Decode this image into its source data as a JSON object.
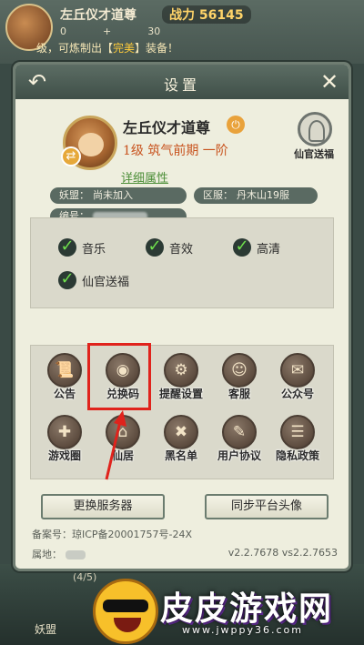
{
  "background": {
    "player_name": "左丘仪才道尊",
    "power_label": "战力",
    "power_value": "56145",
    "counter_left": "0",
    "counter_plus": "+",
    "counter_right": "30",
    "ticker_prefix": "级，可炼制出【",
    "ticker_highlight": "完美",
    "ticker_suffix": "】装备！",
    "progress": "(4/5)",
    "guild_label": "妖盟",
    "watermark": "皮皮游戏网",
    "watermark_url": "www.jwppy36.com"
  },
  "dialog": {
    "title": "设置",
    "back_icon": "back-arrow-icon",
    "close_icon": "close-icon"
  },
  "profile": {
    "name": "左丘仪才道尊",
    "level": "1级 筑气前期 一阶",
    "blessing_label": "仙官送福",
    "detail_link": "详细属性",
    "guild_label": "妖盟：",
    "guild_value": "尚未加入",
    "server_label": "区服：",
    "server_value": "丹木山19服",
    "code_label": "编号："
  },
  "settings": {
    "items": [
      {
        "label": "音乐",
        "checked": true
      },
      {
        "label": "音效",
        "checked": true
      },
      {
        "label": "高清",
        "checked": true
      },
      {
        "label": "仙官送福",
        "checked": true
      }
    ]
  },
  "grid": {
    "buttons": [
      {
        "label": "公告",
        "glyph": "📜",
        "icon": "notice-scroll-icon"
      },
      {
        "label": "兑换码",
        "glyph": "◉",
        "icon": "redeem-bag-icon"
      },
      {
        "label": "提醒设置",
        "glyph": "⚙",
        "icon": "reminder-icon"
      },
      {
        "label": "客服",
        "glyph": "☺",
        "icon": "support-icon"
      },
      {
        "label": "公众号",
        "glyph": "✉",
        "icon": "wechat-icon"
      },
      {
        "label": "游戏圈",
        "glyph": "✚",
        "icon": "gamepad-icon"
      },
      {
        "label": "仙居",
        "glyph": "⌂",
        "icon": "residence-icon"
      },
      {
        "label": "黑名单",
        "glyph": "✖",
        "icon": "blacklist-icon"
      },
      {
        "label": "用户协议",
        "glyph": "✎",
        "icon": "user-agreement-icon"
      },
      {
        "label": "隐私政策",
        "glyph": "☰",
        "icon": "privacy-policy-icon"
      }
    ]
  },
  "actions": {
    "switch_server": "更换服务器",
    "sync_avatar": "同步平台头像"
  },
  "footer": {
    "icp_label": "备案号：",
    "icp_value": "琼ICP备20001757号-24X",
    "location_label": "属地：",
    "version": "v2.2.7678 vs2.2.7653"
  },
  "colors": {
    "highlight": "#e0231c",
    "check_mark": "#6fe04c",
    "level_text": "#c8531e",
    "link_text": "#4e8f3a"
  }
}
